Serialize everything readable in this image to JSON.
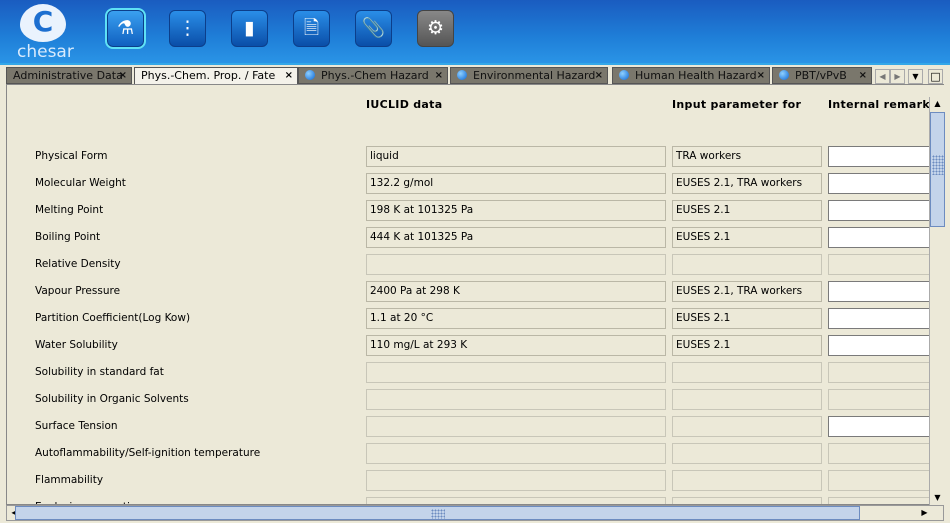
{
  "app": {
    "logo_text": "chesar",
    "logo_letter": "C"
  },
  "toolbar": [
    {
      "icon": "flask-icon",
      "glyph": "⚗",
      "selected": true
    },
    {
      "icon": "tree-icon",
      "glyph": "⋮",
      "selected": false
    },
    {
      "icon": "bar-chart-icon",
      "glyph": "▮",
      "selected": false
    },
    {
      "icon": "document-icon",
      "glyph": "🗎",
      "selected": false
    },
    {
      "icon": "paperclip-icon",
      "glyph": "📎",
      "selected": false
    },
    {
      "icon": "gear-icon",
      "glyph": "⚙",
      "selected": false
    }
  ],
  "tabs": [
    {
      "label": "Administrative Data",
      "dot": false,
      "active": false
    },
    {
      "label": "Phys.-Chem. Prop. / Fate",
      "dot": false,
      "active": true
    },
    {
      "label": "Phys.-Chem Hazard",
      "dot": true,
      "active": false
    },
    {
      "label": "Environmental Hazard",
      "dot": true,
      "active": false
    },
    {
      "label": "Human Health Hazard",
      "dot": true,
      "active": false
    },
    {
      "label": "PBT/vPvB",
      "dot": true,
      "active": false
    }
  ],
  "tab_close": "×",
  "columns": {
    "iuclid": "IUCLID data",
    "input": "Input parameter for",
    "remarks": "Internal remarks"
  },
  "rows": [
    {
      "label": "Physical Form",
      "iuclid": "liquid",
      "input": "TRA workers",
      "editable": true
    },
    {
      "label": "Molecular Weight",
      "iuclid": "132.2 g/mol",
      "input": "EUSES 2.1, TRA workers",
      "editable": true
    },
    {
      "label": "Melting Point",
      "iuclid": "198 K at 101325 Pa",
      "input": "EUSES 2.1",
      "editable": true
    },
    {
      "label": "Boiling Point",
      "iuclid": "444 K at 101325 Pa",
      "input": "EUSES 2.1",
      "editable": true
    },
    {
      "label": "Relative Density",
      "iuclid": "",
      "input": "",
      "editable": false
    },
    {
      "label": "Vapour Pressure",
      "iuclid": "2400 Pa at 298 K",
      "input": "EUSES 2.1, TRA workers",
      "editable": true
    },
    {
      "label": "Partition Coefficient(Log Kow)",
      "iuclid": "1.1 at 20 °C",
      "input": "EUSES 2.1",
      "editable": true
    },
    {
      "label": "Water Solubility",
      "iuclid": "110 mg/L at 293 K",
      "input": "EUSES 2.1",
      "editable": true
    },
    {
      "label": "Solubility in standard fat",
      "iuclid": "",
      "input": "",
      "editable": false
    },
    {
      "label": "Solubility in Organic Solvents",
      "iuclid": "",
      "input": "",
      "editable": false
    },
    {
      "label": "Surface Tension",
      "iuclid": "",
      "input": "",
      "editable": true
    },
    {
      "label": "Autoflammability/Self-ignition temperature",
      "iuclid": "",
      "input": "",
      "editable": false
    },
    {
      "label": "Flammability",
      "iuclid": "",
      "input": "",
      "editable": false
    },
    {
      "label": "Explosive properties",
      "iuclid": "",
      "input": "",
      "editable": false
    }
  ]
}
